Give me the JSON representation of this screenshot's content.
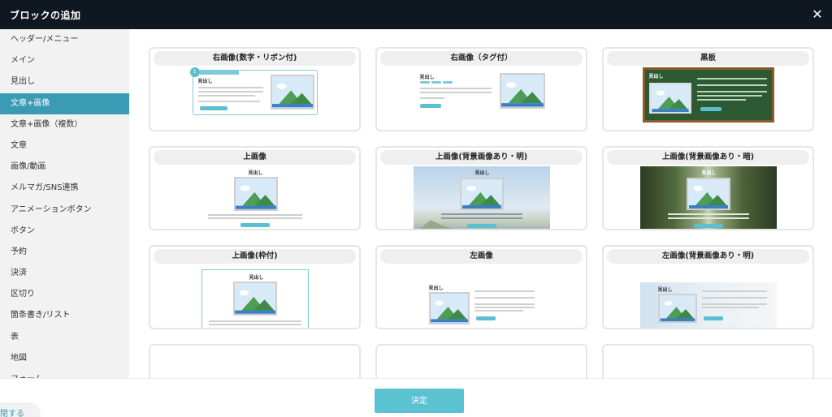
{
  "modal": {
    "title": "ブロックの追加",
    "close_label": "✕"
  },
  "sidebar": {
    "items": [
      {
        "label": "ヘッダー/メニュー"
      },
      {
        "label": "メイン"
      },
      {
        "label": "見出し"
      },
      {
        "label": "文章+画像"
      },
      {
        "label": "文章+画像（複数）"
      },
      {
        "label": "文章"
      },
      {
        "label": "画像/動画"
      },
      {
        "label": "メルマガ/SNS連携"
      },
      {
        "label": "アニメーションボタン"
      },
      {
        "label": "ボタン"
      },
      {
        "label": "予約"
      },
      {
        "label": "決済"
      },
      {
        "label": "区切り"
      },
      {
        "label": "箇条書き/リスト"
      },
      {
        "label": "表"
      },
      {
        "label": "地図"
      },
      {
        "label": "フォーム"
      }
    ],
    "active_index": 3
  },
  "cards": [
    {
      "title": "右画像(数字・リボン付)"
    },
    {
      "title": "右画像（タグ付）"
    },
    {
      "title": "黒板"
    },
    {
      "title": "上画像"
    },
    {
      "title": "上画像(背景画像あり・明)"
    },
    {
      "title": "上画像(背景画像あり・暗)"
    },
    {
      "title": "上画像(枠付)"
    },
    {
      "title": "左画像"
    },
    {
      "title": "左画像(背景画像あり・明)"
    }
  ],
  "thumb_text": {
    "heading": "見出し",
    "number": "1"
  },
  "footer": {
    "decide_label": "決定",
    "corner_label": "閉する"
  },
  "colors": {
    "accent": "#3a9bb4",
    "button": "#5bc2d2",
    "header_bg": "#0f1820"
  }
}
